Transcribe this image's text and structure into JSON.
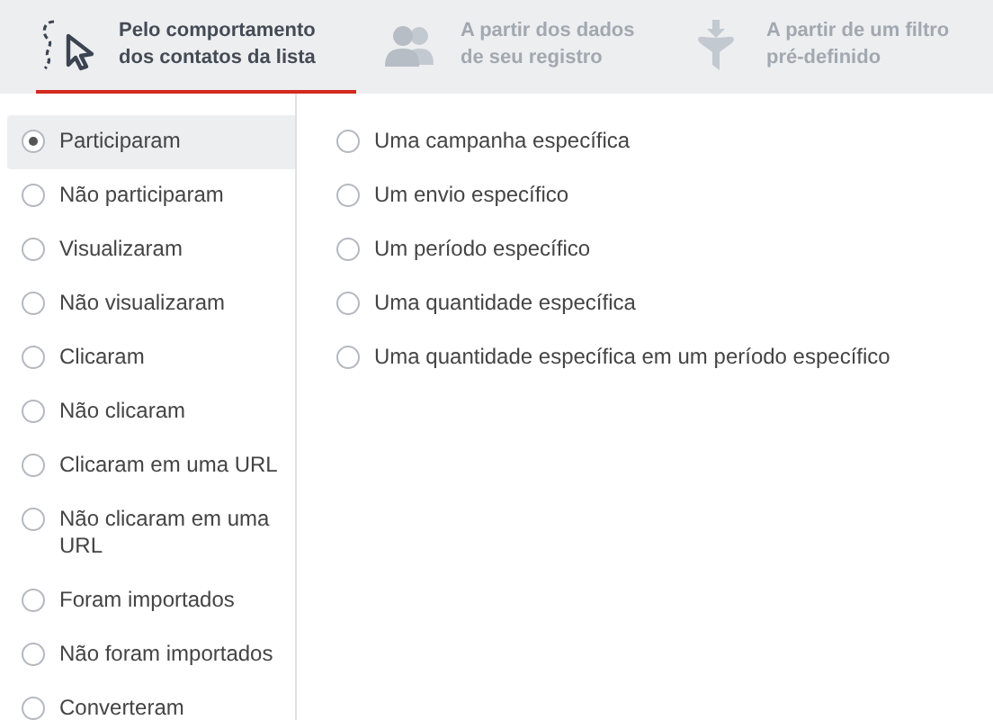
{
  "tabs": [
    {
      "kind": "cursor",
      "label": "Pelo comportamento dos contatos da lista",
      "selected": true
    },
    {
      "kind": "people",
      "label": "A partir dos dados de seu registro",
      "selected": false
    },
    {
      "kind": "funnel",
      "label": "A partir de um filtro pré-definido",
      "selected": false
    }
  ],
  "behaviors": [
    {
      "label": "Participaram",
      "selected": true
    },
    {
      "label": "Não participaram",
      "selected": false
    },
    {
      "label": "Visualizaram",
      "selected": false
    },
    {
      "label": "Não visualizaram",
      "selected": false
    },
    {
      "label": "Clicaram",
      "selected": false
    },
    {
      "label": "Não clicaram",
      "selected": false
    },
    {
      "label": "Clicaram em uma URL",
      "selected": false
    },
    {
      "label": "Não clicaram em uma URL",
      "selected": false
    },
    {
      "label": "Foram importados",
      "selected": false
    },
    {
      "label": "Não foram importados",
      "selected": false
    },
    {
      "label": "Converteram",
      "selected": false
    }
  ],
  "scopes": [
    {
      "label": "Uma campanha específica",
      "selected": false
    },
    {
      "label": "Um envio específico",
      "selected": false
    },
    {
      "label": "Um período específico",
      "selected": false
    },
    {
      "label": "Uma quantidade específica",
      "selected": false
    },
    {
      "label": "Uma quantidade específica em um período específico",
      "selected": false
    }
  ]
}
